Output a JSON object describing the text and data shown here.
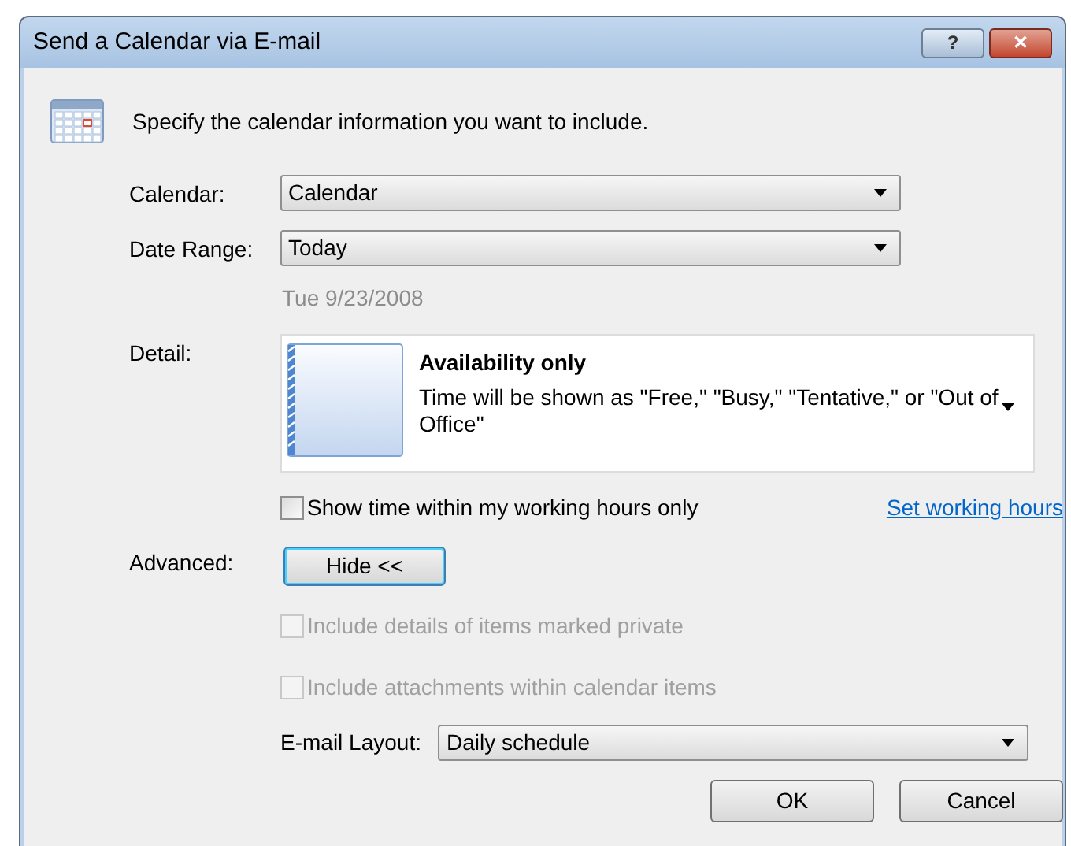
{
  "window": {
    "title": "Send a Calendar via E-mail",
    "help_button": "?",
    "close_button": "✕"
  },
  "intro": "Specify the calendar information you want to include.",
  "calendar": {
    "label": "Calendar:",
    "value": "Calendar"
  },
  "date_range": {
    "label": "Date Range:",
    "value": "Today",
    "date": "Tue 9/23/2008"
  },
  "detail": {
    "label": "Detail:",
    "title": "Availability only",
    "description": "Time will be shown as \"Free,\" \"Busy,\" \"Tentative,\" or \"Out of Office\""
  },
  "working_hours": {
    "label": "Show time within my working hours only",
    "checked": false,
    "disabled": false,
    "link": "Set working hours"
  },
  "advanced": {
    "label": "Advanced:",
    "button": "Hide <<"
  },
  "options": [
    {
      "label": "Include details of items marked private",
      "checked": false,
      "disabled": true
    },
    {
      "label": "Include attachments within calendar items",
      "checked": false,
      "disabled": true
    }
  ],
  "email_layout": {
    "label": "E-mail Layout:",
    "value": "Daily schedule"
  },
  "buttons": [
    "OK",
    "Cancel"
  ]
}
